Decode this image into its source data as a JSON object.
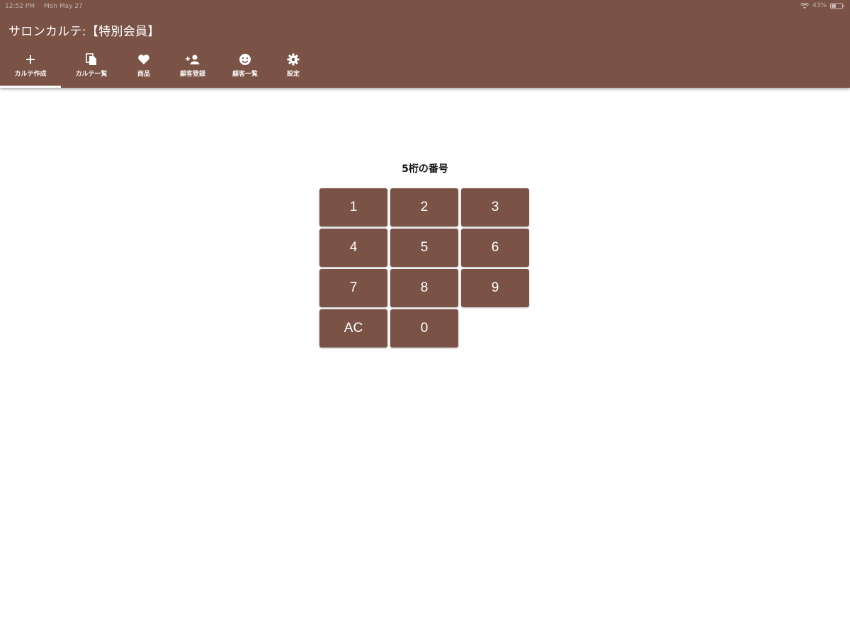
{
  "status_bar": {
    "time": "12:52 PM",
    "date": "Mon May 27",
    "battery": "43%",
    "icons": [
      "wifi-icon",
      "battery-icon"
    ]
  },
  "app_bar": {
    "title": "サロンカルテ:【特別会員】",
    "color": "#7a5246",
    "tabs": [
      {
        "label": "カルテ作成",
        "icon": "plus-icon",
        "active": true
      },
      {
        "label": "カルテ一覧",
        "icon": "documents-icon",
        "active": false
      },
      {
        "label": "商品",
        "icon": "heart-icon",
        "active": false
      },
      {
        "label": "顧客登録",
        "icon": "add-person-icon",
        "active": false
      },
      {
        "label": "顧客一覧",
        "icon": "face-icon",
        "active": false
      },
      {
        "label": "設定",
        "icon": "gear-icon",
        "active": false
      }
    ]
  },
  "keypad": {
    "label": "5桁の番号",
    "keys": [
      "1",
      "2",
      "3",
      "4",
      "5",
      "6",
      "7",
      "8",
      "9",
      "AC",
      "0"
    ],
    "key_color": "#7a5246"
  }
}
